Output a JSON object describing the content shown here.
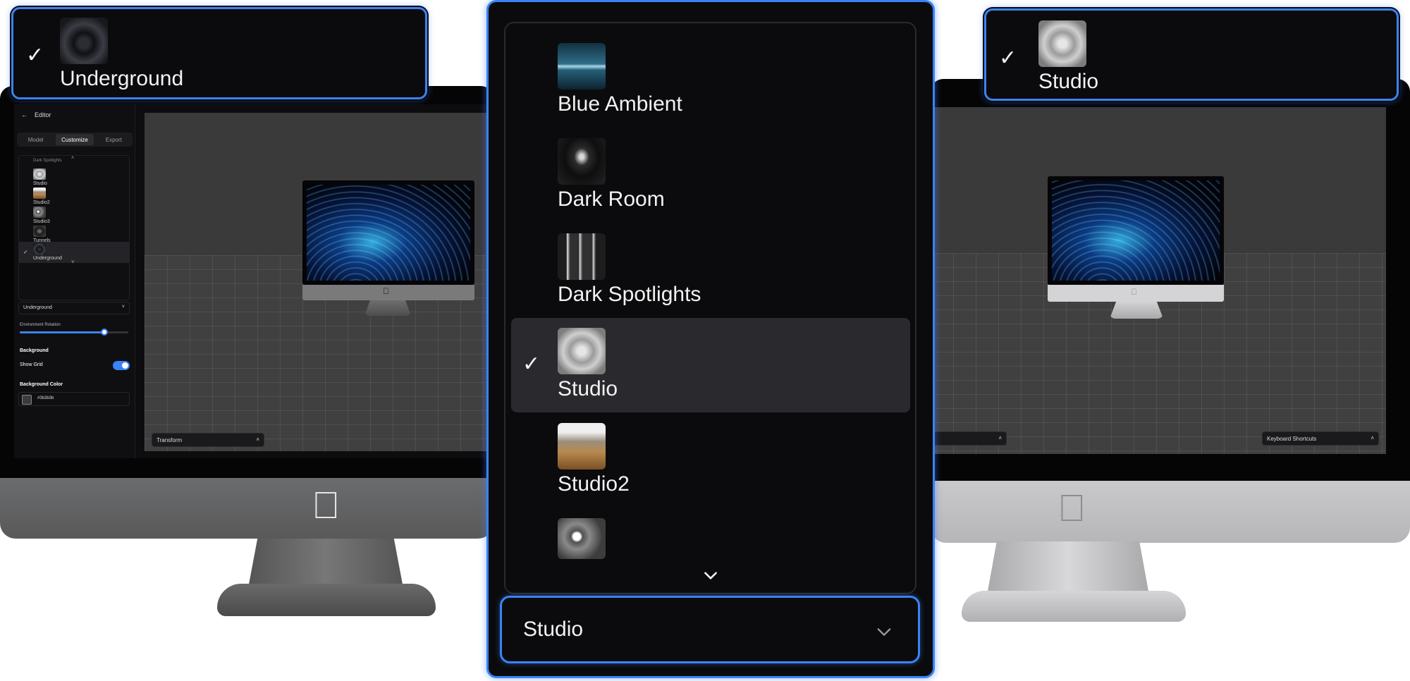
{
  "left_callout": {
    "label": "Underground",
    "thumb": "underground-environment",
    "checked": true
  },
  "right_callout": {
    "label": "Studio",
    "thumb": "studio-environment",
    "checked": true
  },
  "editor": {
    "title": "Editor",
    "back_icon": "arrow-left-icon",
    "tabs": [
      "Model",
      "Customize",
      "Export"
    ],
    "active_tab": "Customize",
    "env_list_cutoff": "Dark Spotlights",
    "env_list": [
      "Studio",
      "Studio2",
      "Studio3",
      "Tunnels",
      "Underground"
    ],
    "env_selected": "Underground",
    "env_select_value": "Underground",
    "rotation_label": "Environment Rotation",
    "rotation_value_fraction": 0.78,
    "background_heading": "Background",
    "show_grid_label": "Show Grid",
    "show_grid_on": true,
    "bg_color_label": "Background Color",
    "bg_color_value": "#3b3b3b",
    "transform_label": "Transform"
  },
  "right_viewport": {
    "keyboard_label": "Keyboard Shortcuts"
  },
  "dropdown": {
    "items": [
      {
        "label": "Blue Ambient",
        "thumb": "blue-ambient-environment"
      },
      {
        "label": "Dark Room",
        "thumb": "dark-room-environment"
      },
      {
        "label": "Dark Spotlights",
        "thumb": "dark-spotlights-environment"
      },
      {
        "label": "Studio",
        "thumb": "studio-environment",
        "selected": true
      },
      {
        "label": "Studio2",
        "thumb": "studio2-environment"
      },
      {
        "label": "",
        "thumb": "studio3-environment"
      }
    ],
    "selected_value": "Studio"
  },
  "colors": {
    "accent": "#3b82f6",
    "panel": "#0b0b0d",
    "viewport": "#3a3a3b"
  }
}
